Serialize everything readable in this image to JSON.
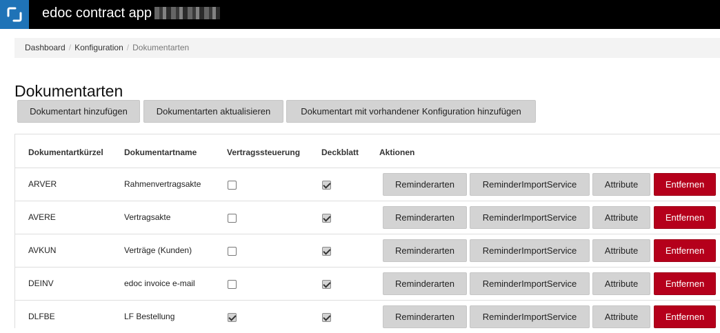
{
  "app": {
    "title": "edoc contract app",
    "brand_color": "#1f73b7"
  },
  "breadcrumb": {
    "items": [
      "Dashboard",
      "Konfiguration"
    ],
    "current": "Dokumentarten"
  },
  "page": {
    "title": "Dokumentarten"
  },
  "toolbar": {
    "add_label": "Dokumentart hinzufügen",
    "refresh_label": "Dokumentarten aktualisieren",
    "add_with_config_label": "Dokumentart mit vorhandener Konfiguration hinzufügen"
  },
  "table": {
    "headers": [
      "Dokumentartkürzel",
      "Dokumentartname",
      "Vertragssteuerung",
      "Deckblatt",
      "Aktionen"
    ],
    "actions": {
      "reminder": "Reminderarten",
      "import": "ReminderImportService",
      "attribute": "Attribute",
      "remove": "Entfernen"
    },
    "rows": [
      {
        "code": "ARVER",
        "name": "Rahmenvertragsakte",
        "vertragssteuerung": false,
        "deckblatt": true
      },
      {
        "code": "AVERE",
        "name": "Vertragsakte",
        "vertragssteuerung": false,
        "deckblatt": true
      },
      {
        "code": "AVKUN",
        "name": "Verträge (Kunden)",
        "vertragssteuerung": false,
        "deckblatt": true
      },
      {
        "code": "DEINV",
        "name": "edoc invoice e-mail",
        "vertragssteuerung": false,
        "deckblatt": true
      },
      {
        "code": "DLFBE",
        "name": "LF Bestellung",
        "vertragssteuerung": true,
        "deckblatt": true
      }
    ]
  },
  "colors": {
    "danger": "#b5001b",
    "button_gray": "#d3d3d3"
  }
}
